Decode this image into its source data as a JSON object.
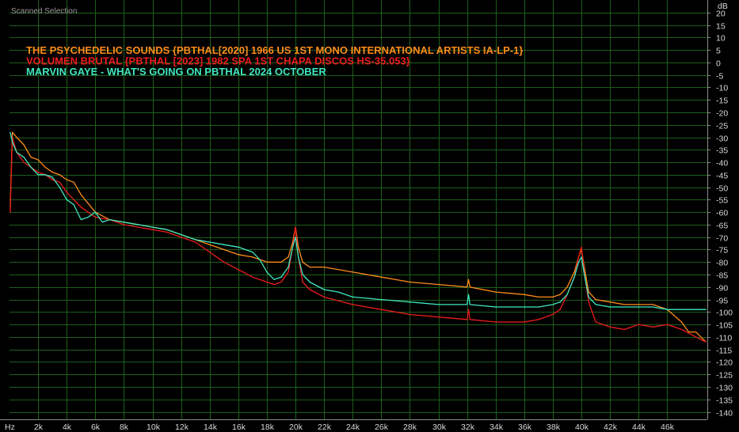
{
  "window": {
    "title": "Scanned Selection"
  },
  "chart_data": {
    "type": "line",
    "xlabel": "Hz",
    "ylabel": "dB",
    "xlim": [
      0,
      48800
    ],
    "ylim": [
      -143,
      25
    ],
    "x_ticks": [
      {
        "value": 2000,
        "label": "2k"
      },
      {
        "value": 4000,
        "label": "4k"
      },
      {
        "value": 6000,
        "label": "6k"
      },
      {
        "value": 8000,
        "label": "8k"
      },
      {
        "value": 10000,
        "label": "10k"
      },
      {
        "value": 12000,
        "label": "12k"
      },
      {
        "value": 14000,
        "label": "14k"
      },
      {
        "value": 16000,
        "label": "16k"
      },
      {
        "value": 18000,
        "label": "18k"
      },
      {
        "value": 20000,
        "label": "20k"
      },
      {
        "value": 22000,
        "label": "22k"
      },
      {
        "value": 24000,
        "label": "24k"
      },
      {
        "value": 26000,
        "label": "26k"
      },
      {
        "value": 28000,
        "label": "28k"
      },
      {
        "value": 30000,
        "label": "30k"
      },
      {
        "value": 32000,
        "label": "32k"
      },
      {
        "value": 34000,
        "label": "34k"
      },
      {
        "value": 36000,
        "label": "36k"
      },
      {
        "value": 38000,
        "label": "38k"
      },
      {
        "value": 40000,
        "label": "40k"
      },
      {
        "value": 42000,
        "label": "42k"
      },
      {
        "value": 44000,
        "label": "44k"
      },
      {
        "value": 46000,
        "label": "46k"
      }
    ],
    "y_ticks": [
      20,
      15,
      10,
      5,
      0,
      -5,
      -10,
      -15,
      -20,
      -25,
      -30,
      -35,
      -40,
      -45,
      -50,
      -55,
      -60,
      -65,
      -70,
      -75,
      -80,
      -85,
      -90,
      -95,
      -100,
      -105,
      -110,
      -115,
      -120,
      -125,
      -130,
      -135,
      -140
    ],
    "grid": true,
    "legend_position": "top-left",
    "series": [
      {
        "name": "THE PSYCHEDELIC SOUNDS {PBTHAL[2020] 1966 US 1ST MONO INTERNATIONAL ARTISTS IA-LP-1}",
        "color": "#ff8c1a",
        "x": [
          50,
          200,
          500,
          1000,
          1500,
          2000,
          2500,
          3000,
          3500,
          4000,
          4500,
          5000,
          6000,
          7000,
          8000,
          9000,
          10000,
          11000,
          12000,
          13000,
          14000,
          15000,
          16000,
          17000,
          18000,
          19000,
          19500,
          19800,
          20000,
          20200,
          20500,
          21000,
          22000,
          24000,
          26000,
          28000,
          30000,
          32000,
          32100,
          32200,
          34000,
          36000,
          37000,
          38000,
          38500,
          39000,
          39500,
          39800,
          40000,
          40200,
          40500,
          41000,
          42000,
          43000,
          44000,
          45000,
          46000,
          47000,
          47500,
          48000,
          48700
        ],
        "values": [
          -58,
          -28,
          -30,
          -33,
          -38,
          -39,
          -42,
          -44,
          -45,
          -47,
          -48,
          -53,
          -60,
          -63,
          -64,
          -65,
          -66,
          -67,
          -69,
          -71,
          -73,
          -75,
          -77,
          -78,
          -80,
          -80,
          -78,
          -72,
          -66,
          -74,
          -80,
          -82,
          -82,
          -84,
          -86,
          -88,
          -89,
          -90,
          -87,
          -90,
          -92,
          -93,
          -94,
          -94,
          -93,
          -90,
          -84,
          -78,
          -75,
          -82,
          -92,
          -95,
          -96,
          -97,
          -97,
          -97,
          -99,
          -104,
          -108,
          -108,
          -112
        ]
      },
      {
        "name": "VOLUMEN BRUTAL {PBTHAL [2023] 1982 SPA 1ST CHAPA DISCOS HS-35.053}",
        "color": "#ee1c1c",
        "x": [
          50,
          200,
          500,
          1000,
          1500,
          2000,
          2500,
          3000,
          3500,
          4000,
          5000,
          6000,
          7000,
          8000,
          9000,
          10000,
          11000,
          12000,
          13000,
          14000,
          15000,
          16000,
          17000,
          18000,
          18500,
          19000,
          19500,
          19800,
          20000,
          20200,
          20500,
          21000,
          22000,
          24000,
          26000,
          28000,
          30000,
          32000,
          32100,
          32200,
          34000,
          36000,
          37000,
          38000,
          38500,
          39000,
          39500,
          39800,
          40000,
          40200,
          40500,
          41000,
          42000,
          43000,
          44000,
          45000,
          46000,
          47000,
          48000,
          48700
        ],
        "values": [
          -60,
          -30,
          -36,
          -40,
          -42,
          -44,
          -45,
          -47,
          -48,
          -52,
          -58,
          -62,
          -63,
          -65,
          -66,
          -67,
          -68,
          -70,
          -72,
          -76,
          -80,
          -83,
          -86,
          -88,
          -89,
          -88,
          -84,
          -74,
          -66,
          -78,
          -88,
          -91,
          -94,
          -97,
          -99,
          -101,
          -102,
          -103,
          -99,
          -103,
          -104,
          -104,
          -103,
          -101,
          -99,
          -93,
          -86,
          -78,
          -74,
          -84,
          -96,
          -104,
          -106,
          -107,
          -105,
          -106,
          -105,
          -107,
          -110,
          -112
        ]
      },
      {
        "name": "MARVIN GAYE - WHAT'S GOING ON PBTHAL 2024 OCTOBER",
        "color": "#3fe8c0",
        "x": [
          50,
          200,
          500,
          1000,
          1500,
          2000,
          2500,
          3000,
          3500,
          4000,
          4500,
          5000,
          5500,
          6000,
          6500,
          7000,
          8000,
          9000,
          10000,
          11000,
          12000,
          13000,
          14000,
          15000,
          16000,
          17000,
          17500,
          18000,
          18500,
          19000,
          19500,
          19800,
          20000,
          20200,
          20500,
          21000,
          22000,
          23000,
          24000,
          26000,
          28000,
          30000,
          32000,
          32100,
          32200,
          34000,
          36000,
          37000,
          38000,
          38500,
          39000,
          39500,
          39800,
          40000,
          40200,
          40500,
          41000,
          42000,
          43000,
          44000,
          45000,
          46000,
          47000,
          48000,
          48700
        ],
        "values": [
          -28,
          -32,
          -36,
          -38,
          -42,
          -45,
          -45,
          -46,
          -50,
          -55,
          -57,
          -63,
          -62,
          -60,
          -64,
          -63,
          -64,
          -65,
          -66,
          -67,
          -69,
          -71,
          -72,
          -73,
          -74,
          -76,
          -79,
          -84,
          -87,
          -86,
          -82,
          -74,
          -70,
          -78,
          -85,
          -88,
          -91,
          -92,
          -94,
          -95,
          -96,
          -97,
          -97,
          -93,
          -97,
          -98,
          -98,
          -98,
          -97,
          -96,
          -93,
          -86,
          -80,
          -78,
          -85,
          -94,
          -97,
          -98,
          -98,
          -98,
          -98,
          -99,
          -99,
          -99,
          -99
        ]
      }
    ]
  }
}
